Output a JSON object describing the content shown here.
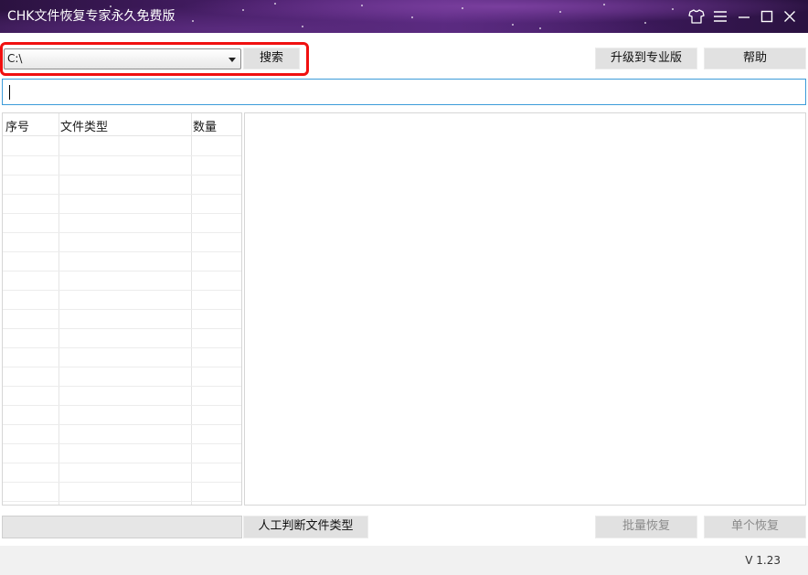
{
  "window": {
    "title": "CHK文件恢复专家永久免费版",
    "controls": [
      "shirt-icon",
      "menu-icon",
      "minimize-icon",
      "maximize-icon",
      "close-icon"
    ]
  },
  "toolbar": {
    "drive_value": "C:\\",
    "search_label": "搜索",
    "upgrade_label": "升级到专业版",
    "help_label": "帮助"
  },
  "search": {
    "value": ""
  },
  "file_list": {
    "columns": [
      "序号",
      "文件类型",
      "数量"
    ],
    "rows": []
  },
  "bottom": {
    "manual_label": "人工判断文件类型",
    "batch_label": "批量恢复",
    "single_label": "单个恢复"
  },
  "status": {
    "version": "V 1.23"
  },
  "colors": {
    "highlight": "#f01010",
    "input_border": "#3c9bd9",
    "title_bg": "#4a1f6c"
  }
}
